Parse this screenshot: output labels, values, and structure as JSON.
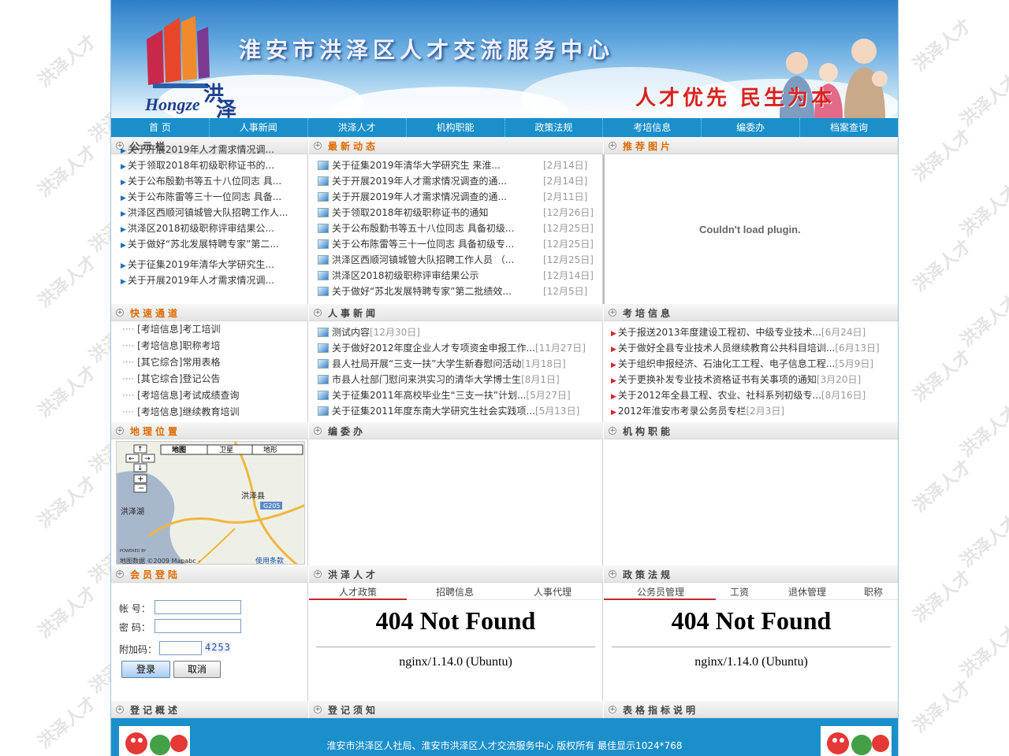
{
  "watermark": "洪泽人才",
  "banner": {
    "title": "淮安市洪泽区人才交流服务中心",
    "slogan": "人才优先 民生为本",
    "logo_text": "Hongze洪泽"
  },
  "nav": [
    "首 页",
    "人事新闻",
    "洪泽人才",
    "机构职能",
    "政策法规",
    "考培信息",
    "编委办",
    "档案查询"
  ],
  "sections": {
    "notice": "公示栏",
    "latest": "最新动态",
    "pictures": "推荐图片",
    "quick": "快速通道",
    "hr_news": "人事新闻",
    "exam": "考培信息",
    "location": "地理位置",
    "bwb": "编委办",
    "org": "机构职能",
    "member_login": "会员登陆",
    "talent": "洪泽人才",
    "policy": "政策法规",
    "reg_overview": "登记概述",
    "reg_notice": "登记须知",
    "table_desc": "表格指标说明"
  },
  "notice_list": [
    "关于开展2019年人才需求情况调...",
    "关于领取2018年初级职称证书的...",
    "关于公布殷勤书等五十八位同志 具...",
    "关于公布陈雷等三十一位同志 具备...",
    "洪泽区西顺河镇城管大队招聘工作人...",
    "洪泽区2018初级职称评审结果公...",
    "关于做好“苏北发展特聘专家”第二...",
    "关于征集2019年清华大学研究生...",
    "关于开展2019年人才需求情况调..."
  ],
  "latest_list": [
    {
      "title": "关于征集2019年清华大学研究生 来淮...",
      "date": "[2月14日]"
    },
    {
      "title": "关于开展2019年人才需求情况调查的通...",
      "date": "[2月14日]"
    },
    {
      "title": "关于开展2019年人才需求情况调查的通...",
      "date": "[2月11日]"
    },
    {
      "title": "关于领取2018年初级职称证书的通知",
      "date": "[12月26日]"
    },
    {
      "title": "关于公布殷勤书等五十八位同志 具备初级...",
      "date": "[12月25日]"
    },
    {
      "title": "关于公布陈雷等三十一位同志 具备初级专...",
      "date": "[12月25日]"
    },
    {
      "title": "洪泽区西顺河镇城管大队招聘工作人员 （...",
      "date": "[12月25日]"
    },
    {
      "title": "洪泽区2018初级职称评审结果公示",
      "date": "[12月14日]"
    },
    {
      "title": "关于做好“苏北发展特聘专家”第二批绩效...",
      "date": "[12月5日]"
    }
  ],
  "plugin_message": "Couldn't load plugin.",
  "quick_list": [
    "[考培信息]考工培训",
    "[考培信息]职称考培",
    "[其它综合]常用表格",
    "[其它综合]登记公告",
    "[考培信息]考试成绩查询",
    "[考培信息]继续教育培训"
  ],
  "hr_news_list": [
    {
      "title": "测试内容",
      "date": "[12月30日]"
    },
    {
      "title": "关于做好2012年度企业人才专项资金申报工作...",
      "date": "[11月27日]"
    },
    {
      "title": "县人社局开展“三支一扶”大学生新春慰问活动",
      "date": "[1月18日]"
    },
    {
      "title": "市县人社部门慰问来洪实习的清华大学博士生",
      "date": "[8月1日]"
    },
    {
      "title": "关于征集2011年高校毕业生“三支一扶”计划...",
      "date": "[5月27日]"
    },
    {
      "title": "关于征集2011年度东南大学研究生社会实践项...",
      "date": "[5月13日]"
    }
  ],
  "exam_list": [
    {
      "title": "关于报送2013年度建设工程初、中级专业技术...",
      "date": "[6月24日]"
    },
    {
      "title": "关于做好全县专业技术人员继续教育公共科目培训...",
      "date": "[6月13日]"
    },
    {
      "title": "关于组织申报经济、石油化工工程、电子信息工程...",
      "date": "[5月9日]"
    },
    {
      "title": "关于更换补发专业技术资格证书有关事项的通知",
      "date": "[3月20日]"
    },
    {
      "title": "关于2012年全县工程、农业、社科系列初级专...",
      "date": "[8月16日]"
    },
    {
      "title": "2012年淮安市考录公务员专栏",
      "date": "[2月3日]"
    }
  ],
  "map": {
    "tabs": [
      "地图",
      "卫星",
      "地形"
    ],
    "place_county": "洪泽县",
    "place_lake": "洪泽湖",
    "road": "G205",
    "powered_by": "POWERED BY",
    "copyright": "地图数据 ©2009 Mapabc -",
    "terms": "使用条款"
  },
  "login": {
    "account_label": "帐 号：",
    "password_label": "密 码：",
    "captcha_label": "附加码：",
    "captcha_value": "4253",
    "login_button": "登录",
    "cancel_button": "取消"
  },
  "talent_tabs": [
    "人才政策",
    "招聘信息",
    "人事代理"
  ],
  "policy_tabs": [
    "公务员管理",
    "工资",
    "退休管理",
    "职称"
  ],
  "error": {
    "title": "404 Not Found",
    "server": "nginx/1.14.0 (Ubuntu)"
  },
  "footer": {
    "copyright": "淮安市洪泽区人社局、淮安市洪泽区人才交流服务中心 版权所有 最佳显示1024*768"
  },
  "colors": {
    "nav_bg": "#1a8fca",
    "accent_orange": "#e06a00",
    "error_red": "#c62828"
  }
}
